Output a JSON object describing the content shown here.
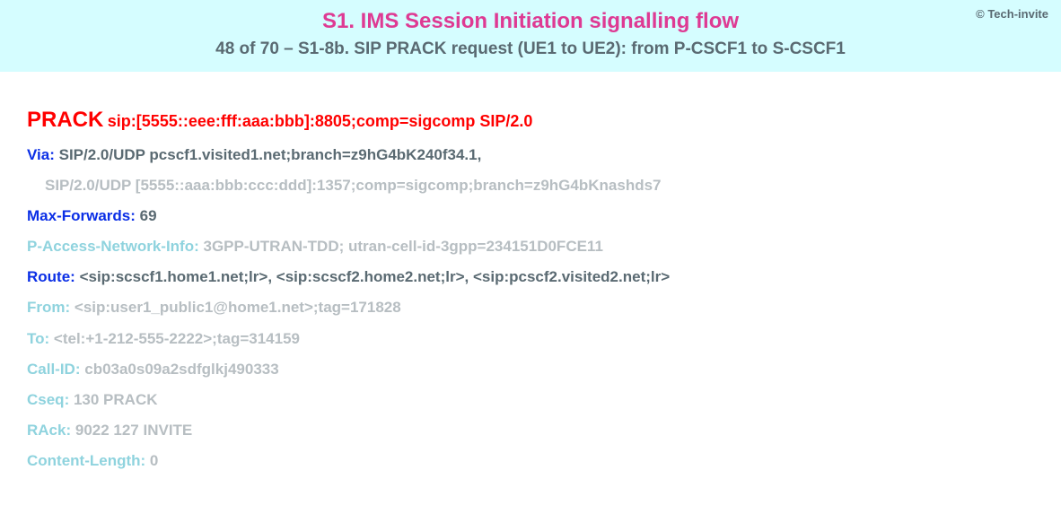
{
  "header": {
    "copyright": "© Tech-invite",
    "title": "S1. IMS Session Initiation signalling flow",
    "subtitle": "48 of 70 – S1-8b. SIP PRACK request (UE1 to UE2): from P-CSCF1 to S-CSCF1"
  },
  "sip": {
    "method": "PRACK",
    "request_uri": "sip:[5555::eee:fff:aaa:bbb]:8805;comp=sigcomp SIP/2.0",
    "headers": [
      {
        "name": "Via",
        "value": "SIP/2.0/UDP pcscf1.visited1.net;branch=z9hG4bK240f34.1,",
        "continuation": "SIP/2.0/UDP [5555::aaa:bbb:ccc:ddd]:1357;comp=sigcomp;branch=z9hG4bKnashds7",
        "emph": true
      },
      {
        "name": "Max-Forwards",
        "value": "69",
        "emph": true
      },
      {
        "name": "P-Access-Network-Info",
        "value": "3GPP-UTRAN-TDD; utran-cell-id-3gpp=234151D0FCE11",
        "emph": false
      },
      {
        "name": "Route",
        "value": "<sip:scscf1.home1.net;lr>, <sip:scscf2.home2.net;lr>, <sip:pcscf2.visited2.net;lr>",
        "emph": true
      },
      {
        "name": "From",
        "value": "<sip:user1_public1@home1.net>;tag=171828",
        "emph": false
      },
      {
        "name": "To",
        "value": "<tel:+1-212-555-2222>;tag=314159",
        "emph": false
      },
      {
        "name": "Call-ID",
        "value": "cb03a0s09a2sdfglkj490333",
        "emph": false
      },
      {
        "name": "Cseq",
        "value": "130 PRACK",
        "emph": false
      },
      {
        "name": "RAck",
        "value": "9022 127 INVITE",
        "emph": false
      },
      {
        "name": "Content-Length",
        "value": "0",
        "emph": false
      }
    ]
  }
}
